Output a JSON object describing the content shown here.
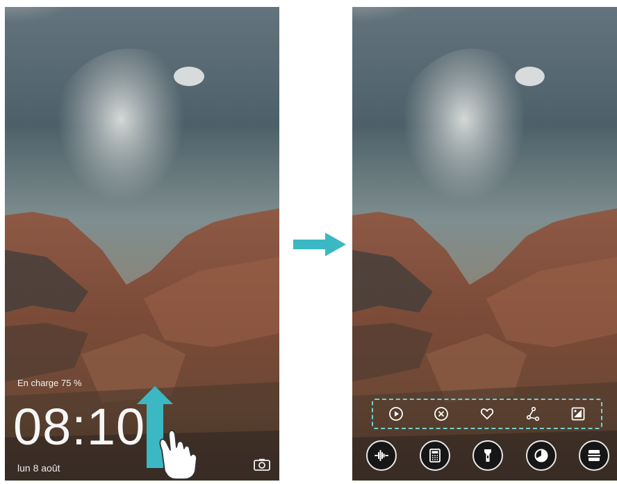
{
  "lock_screen": {
    "charging_text": "En charge 75 %",
    "time": "08:10",
    "date": "lun 8 août"
  },
  "icons": {
    "camera": "camera-icon",
    "swipe_arrow": "swipe-up-arrow-icon",
    "hand": "hand-gesture-icon",
    "transition_arrow": "right-arrow-icon"
  },
  "shortcut_bar": {
    "icons": [
      "play-icon",
      "close-circle-icon",
      "heart-icon",
      "share-icon",
      "gallery-icon"
    ]
  },
  "quick_actions": {
    "icons": [
      "recorder-icon",
      "calculator-icon",
      "flashlight-icon",
      "timer-icon",
      "scanner-icon"
    ]
  },
  "colors": {
    "accent": "#3bb8c4",
    "dashed_border": "#6fd3cf"
  }
}
